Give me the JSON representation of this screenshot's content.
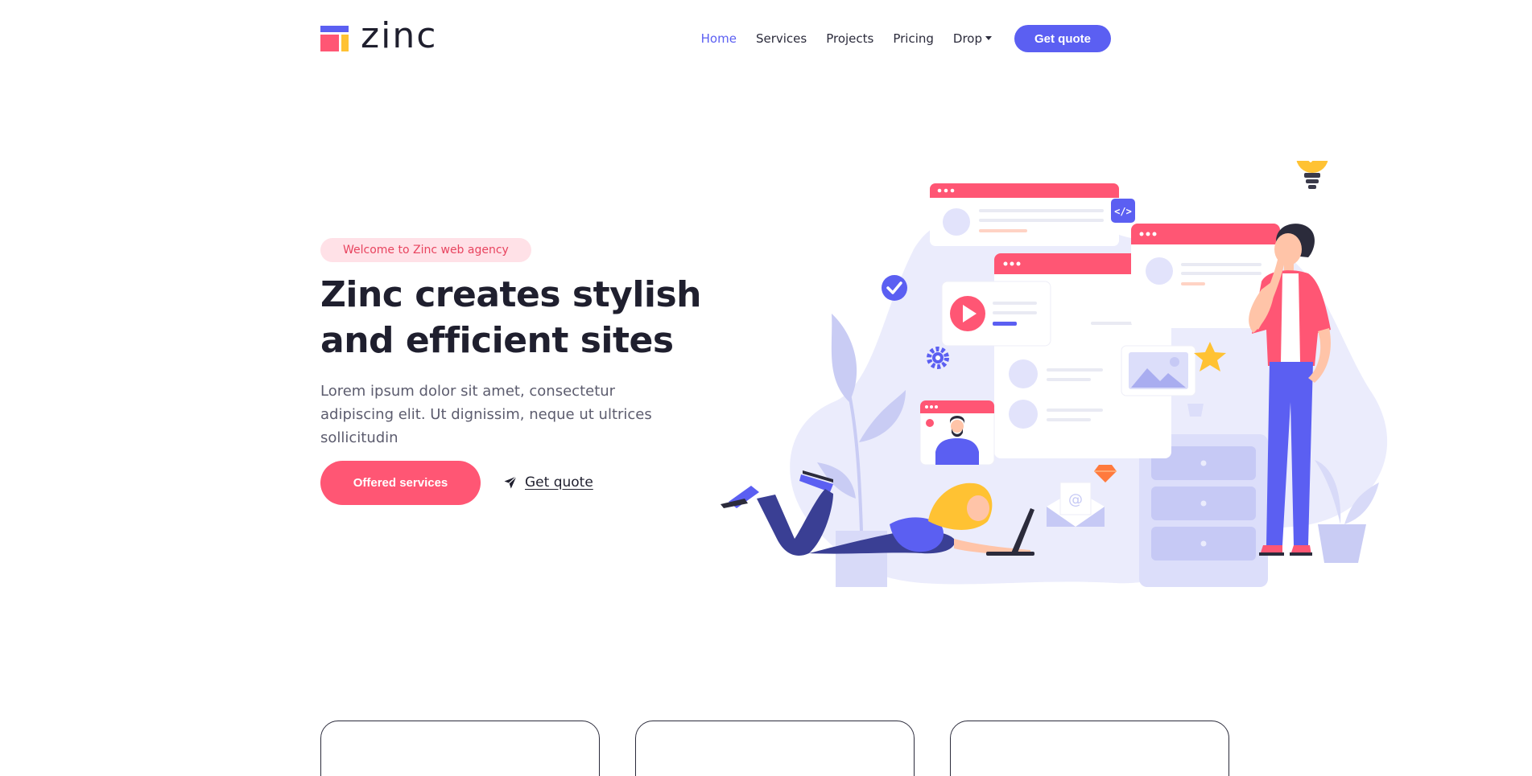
{
  "brand": {
    "name": "zinc",
    "colors": {
      "primary": "#5b5ff2",
      "accent": "#ff5674",
      "yellow": "#ffc233"
    }
  },
  "nav": {
    "items": [
      {
        "label": "Home",
        "active": true
      },
      {
        "label": "Services",
        "active": false
      },
      {
        "label": "Projects",
        "active": false
      },
      {
        "label": "Pricing",
        "active": false
      },
      {
        "label": "Drop",
        "active": false,
        "dropdown": true
      }
    ],
    "cta_label": "Get quote"
  },
  "hero": {
    "badge": "Welcome to Zinc web agency",
    "title_line1": "Zinc creates stylish",
    "title_line2": "and efficient sites",
    "lead": "Lorem ipsum dolor sit amet, consectetur adipiscing elit. Ut dignissim, neque ut ultrices sollicitudin",
    "primary_button": "Offered services",
    "secondary_link": "Get quote",
    "secondary_icon": "paper-plane-icon"
  },
  "services": {
    "cards": [
      {
        "icon_color": "#5b5ff2"
      },
      {
        "icon_color": "#ffc233"
      },
      {
        "icon_color": "#ff5674"
      }
    ]
  }
}
